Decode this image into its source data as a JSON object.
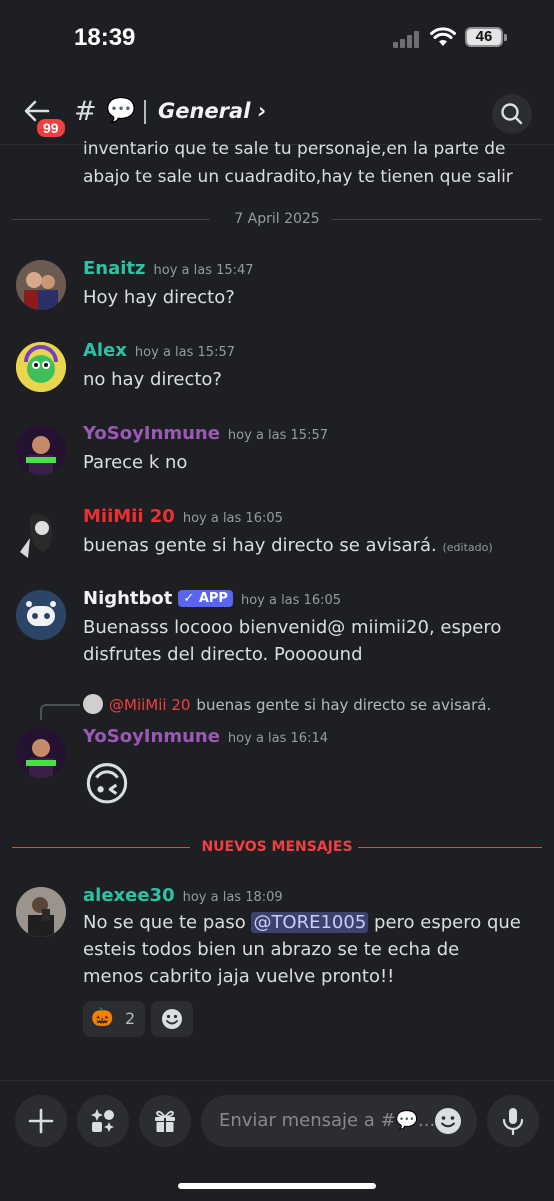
{
  "status": {
    "time": "18:39",
    "battery": "46"
  },
  "header": {
    "badge": "99",
    "hash": "#",
    "channel_emoji": "💬",
    "channel": "General ›"
  },
  "partial_text": "inventario que te sale tu personaje,en la parte de abajo te sale un cuadradito,hay te tienen que salir",
  "date_separator": "7 April 2025",
  "messages": [
    {
      "author": "Enaitz",
      "color": "#2dc2a4",
      "time": "hoy a las 15:47",
      "text": "Hoy hay directo?"
    },
    {
      "author": "Alex",
      "color": "#2dc2a4",
      "time": "hoy a las 15:57",
      "text": "no hay directo?"
    },
    {
      "author": "YoSoyInmune",
      "color": "#9b59b6",
      "time": "hoy a las 15:57",
      "text": "Parece k no"
    },
    {
      "author": "MiiMii 20",
      "color": "#ed2f2f",
      "time": "hoy a las 16:05",
      "text": "buenas gente si hay directo se avisará.",
      "edited": "(editado)"
    },
    {
      "author": "Nightbot",
      "color": "#f2f3f5",
      "badge": "✓ APP",
      "time": "hoy a las 16:05",
      "text": "Buenasss locooo bienvenid@ miimii20, espero disfrutes del directo. Poooound"
    },
    {
      "author": "YoSoyInmune",
      "color": "#9b59b6",
      "time": "hoy a las 16:14",
      "text": "🙃"
    },
    {
      "author": "alexee30",
      "color": "#2dc2a4",
      "time": "hoy a las 18:09",
      "text_before": "No se que te paso ",
      "mention": "@TORE1005",
      "text_after": "  pero espero que esteis todos bien un abrazo  se te echa de menos cabrito jaja vuelve pronto!!"
    }
  ],
  "reply": {
    "name": "@MiiMii 20",
    "text": "buenas gente si hay directo se avisará."
  },
  "new_messages_label": "NUEVOS MENSAJES",
  "reactions": [
    {
      "emoji": "🎃",
      "count": "2"
    }
  ],
  "composer": {
    "placeholder": "Enviar mensaje a #💬..."
  },
  "colors": {
    "background": "#1e1f22",
    "accent": "#5865f2",
    "danger": "#f23f43"
  }
}
